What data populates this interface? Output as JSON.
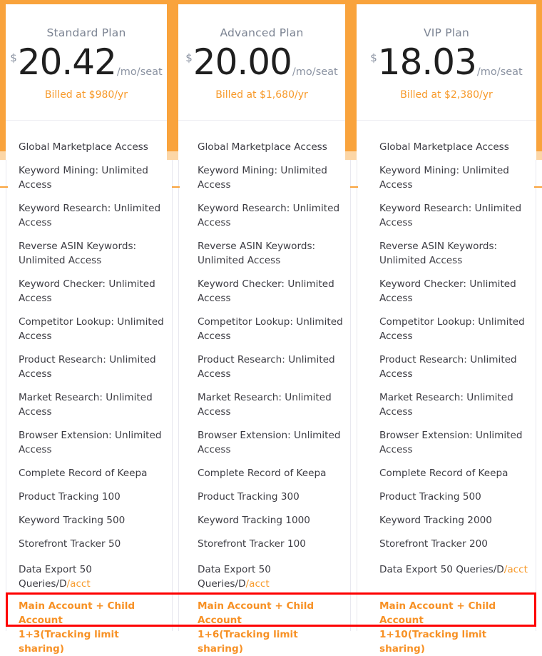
{
  "theme": {
    "accent_orange": "#f9a33c",
    "text_orange": "#f79a2b",
    "highlight_red": "#fe0000",
    "plan_name_color": "#7c8493",
    "price_color": "#1f1f1f",
    "feature_color": "#3c3c43",
    "rule_color": "#e8e8ef"
  },
  "plans": [
    {
      "name": "Standard Plan",
      "currency_symbol": "$",
      "price": "20.42",
      "price_unit": "/mo/seat",
      "billed_note": "Billed at $980/yr",
      "features": [
        "Global Marketplace Access",
        "Keyword Mining: Unlimited Access",
        "Keyword Research: Unlimited Access",
        "Reverse ASIN Keywords: Unlimited Access",
        "Keyword Checker: Unlimited Access",
        "Competitor Lookup: Unlimited Access",
        "Product Research: Unlimited Access",
        "Market Research: Unlimited Access",
        "Browser Extension: Unlimited Access",
        "Complete Record of Keepa",
        "Product Tracking 100",
        "Keyword Tracking 500",
        "Storefront Tracker 50"
      ],
      "data_export": {
        "plain": "Data Export 50 Queries/D",
        "highlight": "/acct"
      },
      "child_account": {
        "line1": "Main Account + Child Account",
        "line2": "1+3(Tracking limit sharing)"
      }
    },
    {
      "name": "Advanced Plan",
      "currency_symbol": "$",
      "price": "20.00",
      "price_unit": "/mo/seat",
      "billed_note": "Billed at $1,680/yr",
      "features": [
        "Global Marketplace Access",
        "Keyword Mining: Unlimited Access",
        "Keyword Research: Unlimited Access",
        "Reverse ASIN Keywords: Unlimited Access",
        "Keyword Checker: Unlimited Access",
        "Competitor Lookup: Unlimited Access",
        "Product Research: Unlimited Access",
        "Market Research: Unlimited Access",
        "Browser Extension: Unlimited Access",
        "Complete Record of Keepa",
        "Product Tracking 300",
        "Keyword Tracking 1000",
        "Storefront Tracker 100"
      ],
      "data_export": {
        "plain": "Data Export 50 Queries/D",
        "highlight": "/acct"
      },
      "child_account": {
        "line1": "Main Account + Child Account",
        "line2": "1+6(Tracking limit sharing)"
      }
    },
    {
      "name": "VIP Plan",
      "currency_symbol": "$",
      "price": "18.03",
      "price_unit": "/mo/seat",
      "billed_note": "Billed at $2,380/yr",
      "features": [
        "Global Marketplace Access",
        "Keyword Mining: Unlimited Access",
        "Keyword Research: Unlimited Access",
        "Reverse ASIN Keywords: Unlimited Access",
        "Keyword Checker: Unlimited Access",
        "Competitor Lookup: Unlimited Access",
        "Product Research: Unlimited Access",
        "Market Research: Unlimited Access",
        "Browser Extension: Unlimited Access",
        "Complete Record of Keepa",
        "Product Tracking 500",
        "Keyword Tracking 2000",
        "Storefront Tracker 200"
      ],
      "data_export": {
        "plain": "Data Export 50 Queries/D",
        "highlight": "/acct"
      },
      "child_account": {
        "line1": "Main Account + Child Account",
        "line2": "1+10(Tracking limit sharing)"
      }
    }
  ]
}
